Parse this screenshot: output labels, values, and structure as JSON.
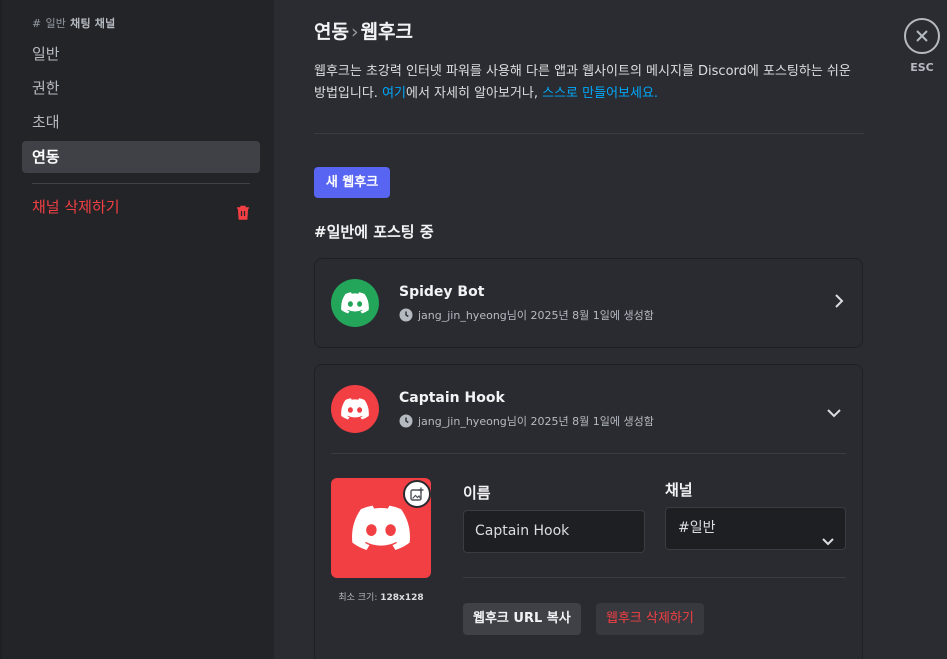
{
  "sidebar": {
    "header_hash": "#",
    "header_channel": "일반",
    "header_title": "채팅 채널",
    "items": [
      {
        "label": "일반"
      },
      {
        "label": "권한"
      },
      {
        "label": "초대"
      },
      {
        "label": "연동"
      }
    ],
    "active_item": "연동",
    "delete_label": "채널 삭제하기"
  },
  "main": {
    "breadcrumb_parent": "연동",
    "breadcrumb_sep": "›",
    "breadcrumb_current": "웹후크",
    "description_1": "웹후크는 초강력 인터넷 파워를 사용해 다른 앱과 웹사이트의 메시지를 Discord에 포스팅하는 쉬운 방법입니다. ",
    "link_here": "여기",
    "description_2": "에서 자세히 알아보거나, ",
    "link_make": "스스로 만들어보세요.",
    "new_webhook_label": "새 웹후크",
    "section_title": "#일반에 포스팅 중"
  },
  "webhooks": [
    {
      "name": "Spidey Bot",
      "creator": "jang_jin_hyeong",
      "meta": "님이 2025년 8월 1일에 생성함",
      "avatar_color": "#23a55a",
      "expanded": false
    },
    {
      "name": "Captain Hook",
      "creator": "jang_jin_hyeong",
      "meta": "님이 2025년 8월 1일에 생성함",
      "avatar_color": "#f23f43",
      "expanded": true
    }
  ],
  "editor": {
    "name_label": "이름",
    "name_value": "Captain Hook",
    "channel_label": "채널",
    "channel_value": "#일반",
    "min_size_label": "최소 크기: ",
    "min_size_value": "128x128",
    "copy_url_label": "웹후크 URL 복사",
    "delete_label": "웹후크 삭제하기"
  },
  "close": {
    "label": "ESC"
  },
  "colors": {
    "accent": "#5865f2",
    "danger": "#f23f43",
    "link": "#00a8fc",
    "success": "#23a55a"
  }
}
